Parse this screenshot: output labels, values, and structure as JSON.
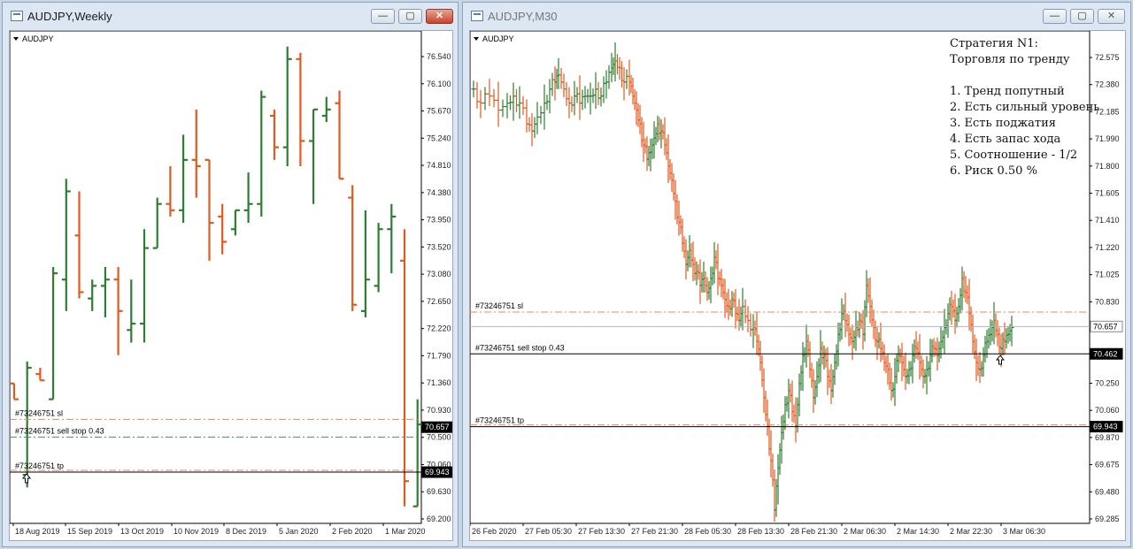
{
  "left_window": {
    "title": "AUDJPY,Weekly",
    "chart_label": "AUDJPY,Weekly",
    "buttons": {
      "minimize": "—",
      "restore": "▢",
      "close": "✕"
    }
  },
  "right_window": {
    "title": "AUDJPY,M30",
    "chart_label": "AUDJPY,M30",
    "buttons": {
      "minimize": "—",
      "restore": "▢",
      "close": "✕"
    },
    "strategy_note": [
      "Стратегия N1:",
      "Торговля по тренду",
      "",
      "1. Тренд попутный",
      "2. Есть сильный уровень",
      "3. Есть поджатия",
      "4. Есть запас хода",
      "5. Соотношение - 1/2",
      "6. Риск 0.50 %"
    ]
  },
  "colors": {
    "bull": "#2e7d32",
    "bear": "#e05a1e",
    "sl_line": "#e0a080",
    "green_dash": "#3a9a4a",
    "axis_text": "#222"
  },
  "chart_data": [
    {
      "type": "ohlc",
      "symbol": "AUDJPY",
      "timeframe": "Weekly",
      "y_axis_ticks": [
        "76.540",
        "76.100",
        "75.670",
        "75.240",
        "74.810",
        "74.380",
        "73.950",
        "73.520",
        "73.080",
        "72.650",
        "72.220",
        "71.790",
        "71.360",
        "70.930",
        "70.500",
        "70.060",
        "69.630",
        "69.200"
      ],
      "ylim": [
        69.2,
        76.54
      ],
      "x_axis_labels": [
        "18 Aug 2019",
        "15 Sep 2019",
        "13 Oct 2019",
        "10 Nov 2019",
        "8 Dec 2019",
        "5 Jan 2020",
        "2 Feb 2020",
        "1 Mar 2020"
      ],
      "price_tags": [
        {
          "text": "70.657",
          "value": 70.657,
          "style": "dark"
        },
        {
          "text": "69.943",
          "value": 69.943,
          "style": "dark"
        }
      ],
      "levels": [
        {
          "label": "#73246751 sl",
          "value": 70.78,
          "style": "sl"
        },
        {
          "label": "#73246751 sell stop 0.43",
          "value": 70.5,
          "style": "green"
        },
        {
          "label": "#73246751 tp",
          "value": 69.943,
          "style": "tp"
        }
      ],
      "bars": [
        [
          71.35,
          71.35,
          71.1,
          71.1
        ],
        [
          69.9,
          71.7,
          69.7,
          71.6
        ],
        [
          71.5,
          71.6,
          71.4,
          71.4
        ],
        [
          71.1,
          73.2,
          71.1,
          73.1
        ],
        [
          73.0,
          74.6,
          72.5,
          74.4
        ],
        [
          73.7,
          74.4,
          72.7,
          72.8
        ],
        [
          72.7,
          73.0,
          72.5,
          72.9
        ],
        [
          72.9,
          73.2,
          72.4,
          73.0
        ],
        [
          73.0,
          73.2,
          71.8,
          72.5
        ],
        [
          72.2,
          73.0,
          72.0,
          72.3
        ],
        [
          72.3,
          73.8,
          72.0,
          73.5
        ],
        [
          73.5,
          74.3,
          73.5,
          74.2
        ],
        [
          74.2,
          74.8,
          74.0,
          74.1
        ],
        [
          74.1,
          75.3,
          73.9,
          74.9
        ],
        [
          74.9,
          75.7,
          74.3,
          74.8
        ],
        [
          74.9,
          74.9,
          73.3,
          73.9
        ],
        [
          74.0,
          74.2,
          73.4,
          73.6
        ],
        [
          73.8,
          74.1,
          73.7,
          74.1
        ],
        [
          74.1,
          74.7,
          73.9,
          74.2
        ],
        [
          74.2,
          76.0,
          74.0,
          75.9
        ],
        [
          75.6,
          75.7,
          74.9,
          75.1
        ],
        [
          75.1,
          76.7,
          74.8,
          76.5
        ],
        [
          76.5,
          76.6,
          74.8,
          75.2
        ],
        [
          75.2,
          75.7,
          74.2,
          75.7
        ],
        [
          75.6,
          75.9,
          75.5,
          75.7
        ],
        [
          75.8,
          76.0,
          74.6,
          74.6
        ],
        [
          74.3,
          74.5,
          72.5,
          72.6
        ],
        [
          72.5,
          74.1,
          72.4,
          73.0
        ],
        [
          72.9,
          73.9,
          72.8,
          73.8
        ],
        [
          73.8,
          74.2,
          73.1,
          74.0
        ],
        [
          73.3,
          73.8,
          69.4,
          69.8
        ],
        [
          69.4,
          71.1,
          69.4,
          70.7
        ]
      ]
    },
    {
      "type": "ohlc",
      "symbol": "AUDJPY",
      "timeframe": "M30",
      "y_axis_ticks": [
        "72.575",
        "72.380",
        "72.185",
        "71.990",
        "71.800",
        "71.605",
        "71.410",
        "71.220",
        "71.025",
        "70.830",
        "70.635",
        "70.445",
        "70.250",
        "70.060",
        "69.870",
        "69.675",
        "69.480",
        "69.285"
      ],
      "ylim": [
        69.285,
        72.575
      ],
      "x_axis_labels": [
        "26 Feb 2020",
        "27 Feb 05:30",
        "27 Feb 13:30",
        "27 Feb 21:30",
        "28 Feb 05:30",
        "28 Feb 13:30",
        "28 Feb 21:30",
        "2 Mar 06:30",
        "2 Mar 14:30",
        "2 Mar 22:30",
        "3 Mar 06:30"
      ],
      "price_tags": [
        {
          "text": "70.657",
          "value": 70.657,
          "style": "light"
        },
        {
          "text": "70.462",
          "value": 70.462,
          "style": "dark"
        },
        {
          "text": "69.943",
          "value": 69.943,
          "style": "dark"
        }
      ],
      "levels": [
        {
          "label": "#73246751 sl",
          "value": 70.76,
          "style": "sl"
        },
        {
          "label": "#73246751 sell stop 0.43",
          "value": 70.462,
          "style": "solid"
        },
        {
          "label": "#73246751 tp",
          "value": 69.943,
          "style": "tp"
        }
      ],
      "price_path": [
        [
          0,
          72.35
        ],
        [
          8,
          72.25
        ],
        [
          18,
          72.3
        ],
        [
          28,
          72.2
        ],
        [
          38,
          72.25
        ],
        [
          45,
          72.3
        ],
        [
          52,
          72.25
        ],
        [
          60,
          72.1
        ],
        [
          66,
          72.05
        ],
        [
          72,
          72.15
        ],
        [
          80,
          72.25
        ],
        [
          86,
          72.35
        ],
        [
          92,
          72.4
        ],
        [
          96,
          72.45
        ],
        [
          102,
          72.35
        ],
        [
          108,
          72.25
        ],
        [
          114,
          72.3
        ],
        [
          120,
          72.25
        ],
        [
          126,
          72.3
        ],
        [
          132,
          72.3
        ],
        [
          138,
          72.35
        ],
        [
          144,
          72.3
        ],
        [
          150,
          72.4
        ],
        [
          156,
          72.5
        ],
        [
          160,
          72.55
        ],
        [
          165,
          72.5
        ],
        [
          170,
          72.4
        ],
        [
          176,
          72.4
        ],
        [
          180,
          72.3
        ],
        [
          184,
          72.2
        ],
        [
          188,
          72.1
        ],
        [
          192,
          71.95
        ],
        [
          196,
          71.85
        ],
        [
          200,
          71.9
        ],
        [
          204,
          72.0
        ],
        [
          208,
          72.1
        ],
        [
          212,
          72.05
        ],
        [
          216,
          71.95
        ],
        [
          220,
          71.8
        ],
        [
          224,
          71.7
        ],
        [
          228,
          71.55
        ],
        [
          232,
          71.4
        ],
        [
          236,
          71.25
        ],
        [
          240,
          71.1
        ],
        [
          244,
          71.2
        ],
        [
          248,
          71.1
        ],
        [
          252,
          71.05
        ],
        [
          256,
          70.95
        ],
        [
          260,
          71.0
        ],
        [
          264,
          70.9
        ],
        [
          268,
          71.0
        ],
        [
          272,
          71.15
        ],
        [
          276,
          71.0
        ],
        [
          280,
          70.95
        ],
        [
          284,
          70.85
        ],
        [
          288,
          70.8
        ],
        [
          292,
          70.85
        ],
        [
          296,
          70.75
        ],
        [
          300,
          70.7
        ],
        [
          304,
          70.8
        ],
        [
          310,
          70.7
        ],
        [
          316,
          70.65
        ],
        [
          320,
          70.55
        ],
        [
          324,
          70.4
        ],
        [
          328,
          70.15
        ],
        [
          332,
          69.95
        ],
        [
          336,
          69.7
        ],
        [
          340,
          69.35
        ],
        [
          344,
          69.65
        ],
        [
          348,
          69.9
        ],
        [
          352,
          70.1
        ],
        [
          356,
          70.2
        ],
        [
          360,
          70.05
        ],
        [
          364,
          69.95
        ],
        [
          368,
          70.25
        ],
        [
          372,
          70.45
        ],
        [
          376,
          70.55
        ],
        [
          380,
          70.35
        ],
        [
          384,
          70.15
        ],
        [
          388,
          70.3
        ],
        [
          392,
          70.5
        ],
        [
          396,
          70.45
        ],
        [
          400,
          70.3
        ],
        [
          404,
          70.2
        ],
        [
          408,
          70.4
        ],
        [
          412,
          70.6
        ],
        [
          416,
          70.75
        ],
        [
          420,
          70.7
        ],
        [
          424,
          70.6
        ],
        [
          428,
          70.55
        ],
        [
          432,
          70.65
        ],
        [
          436,
          70.7
        ],
        [
          440,
          70.6
        ],
        [
          444,
          70.95
        ],
        [
          448,
          70.8
        ],
        [
          452,
          70.65
        ],
        [
          456,
          70.55
        ],
        [
          460,
          70.5
        ],
        [
          464,
          70.4
        ],
        [
          468,
          70.35
        ],
        [
          472,
          70.2
        ],
        [
          476,
          70.3
        ],
        [
          480,
          70.45
        ],
        [
          484,
          70.4
        ],
        [
          488,
          70.3
        ],
        [
          492,
          70.35
        ],
        [
          496,
          70.45
        ],
        [
          500,
          70.5
        ],
        [
          504,
          70.4
        ],
        [
          508,
          70.3
        ],
        [
          512,
          70.35
        ],
        [
          516,
          70.45
        ],
        [
          520,
          70.5
        ],
        [
          524,
          70.45
        ],
        [
          528,
          70.55
        ],
        [
          532,
          70.65
        ],
        [
          536,
          70.75
        ],
        [
          540,
          70.8
        ],
        [
          544,
          70.7
        ],
        [
          548,
          70.8
        ],
        [
          552,
          71.0
        ],
        [
          556,
          70.9
        ],
        [
          560,
          70.75
        ],
        [
          564,
          70.55
        ],
        [
          568,
          70.4
        ],
        [
          572,
          70.35
        ],
        [
          576,
          70.45
        ],
        [
          580,
          70.55
        ],
        [
          584,
          70.6
        ],
        [
          588,
          70.7
        ],
        [
          592,
          70.6
        ],
        [
          596,
          70.5
        ],
        [
          600,
          70.55
        ],
        [
          604,
          70.6
        ],
        [
          608,
          70.65
        ]
      ]
    }
  ]
}
